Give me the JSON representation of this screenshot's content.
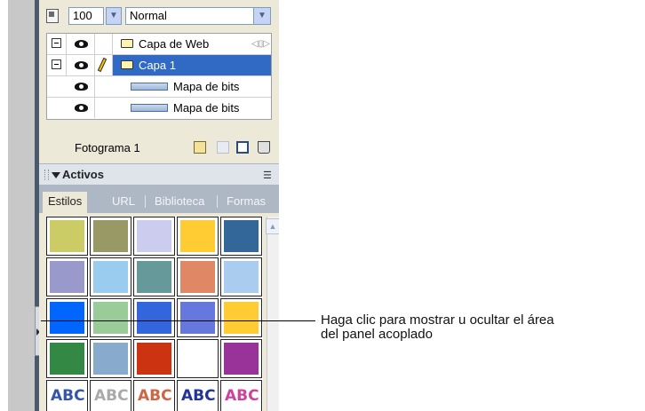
{
  "toolbar": {
    "opacity_value": "100",
    "blend_mode": "Normal"
  },
  "layers": [
    {
      "name": "Capa de Web",
      "type": "web-layer",
      "selected": false
    },
    {
      "name": "Capa 1",
      "type": "folder",
      "selected": true
    },
    {
      "name": "Mapa de bits",
      "type": "bitmap",
      "selected": false
    },
    {
      "name": "Mapa de bits",
      "type": "bitmap",
      "selected": false
    }
  ],
  "frame_bar": {
    "label": "Fotograma 1"
  },
  "assets": {
    "title": "Activos",
    "tabs": [
      "Estilos",
      "URL",
      "Biblioteca",
      "Formas"
    ],
    "active_tab": "Estilos",
    "swatch_colors": [
      [
        "#cccc66",
        "#999966",
        "#ccccee",
        "#ffcc33",
        "#336699"
      ],
      [
        "#9999cc",
        "#99ccee",
        "#669999",
        "#e08866",
        "#aaccee"
      ],
      [
        "#0066ff",
        "#99cc99",
        "#3366dd",
        "#6677dd",
        "#ffcc33"
      ],
      [
        "#338844",
        "#88aacc",
        "#cc3311",
        "#ffffff",
        "#993399"
      ]
    ],
    "text_styles": [
      "ABC",
      "ABC",
      "ABC",
      "ABC",
      "ABC"
    ]
  },
  "callout": {
    "line1": "Haga clic para mostrar u ocultar el área",
    "line2": "del panel acoplado"
  }
}
